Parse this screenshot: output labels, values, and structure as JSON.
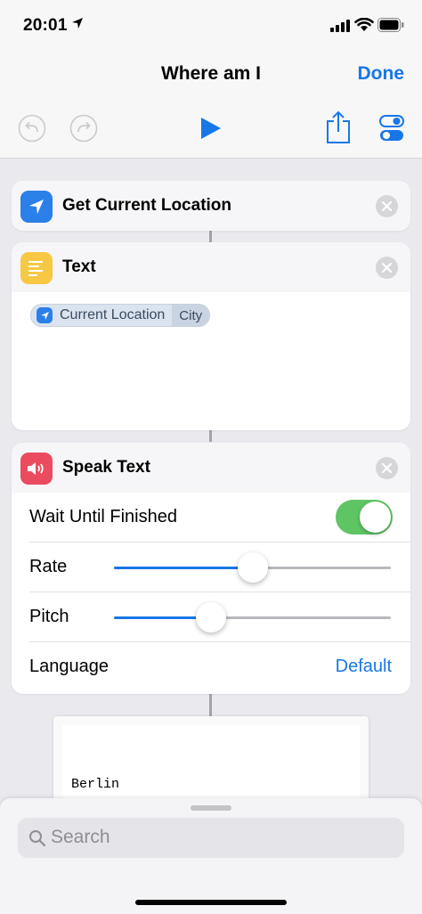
{
  "status_bar": {
    "time": "20:01"
  },
  "nav": {
    "title": "Where am I",
    "done_label": "Done"
  },
  "actions": {
    "get_location": {
      "title": "Get Current Location",
      "icon_color": "#2b7fe8",
      "icon": "location-arrow-icon"
    },
    "text": {
      "title": "Text",
      "icon_color": "#f7c844",
      "icon": "text-lines-icon",
      "token_label": "Current Location",
      "token_property": "City"
    },
    "speak_text": {
      "title": "Speak Text",
      "icon_color": "#ea4b5f",
      "icon": "speaker-icon",
      "wait_label": "Wait Until Finished",
      "wait_on": true,
      "rate_label": "Rate",
      "rate_value": 0.5,
      "pitch_label": "Pitch",
      "pitch_value": 0.35,
      "language_label": "Language",
      "language_value": "Default"
    }
  },
  "output": {
    "text": "Berlin"
  },
  "search": {
    "placeholder": "Search"
  },
  "colors": {
    "accent": "#1877e6",
    "switch_on": "#5ec464"
  }
}
